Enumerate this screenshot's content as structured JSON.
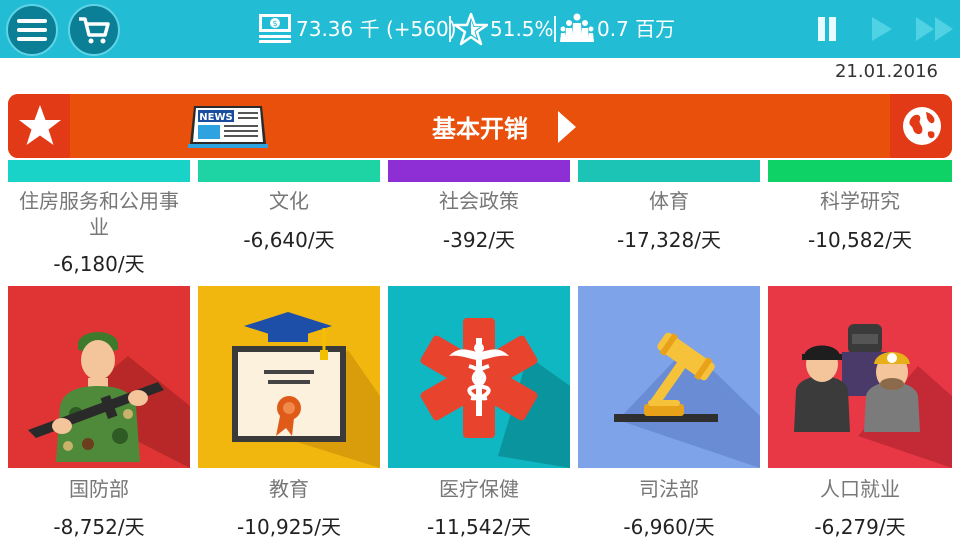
{
  "topbar": {
    "money": "73.36 千 (+560)",
    "approval": "51.5%",
    "population": "0.7 百万",
    "icons": [
      "menu-icon",
      "cart-icon",
      "money-icon",
      "star-icon",
      "people-icon",
      "pause-icon",
      "play-icon",
      "fast-forward-icon"
    ]
  },
  "date": "21.01.2016",
  "banner": {
    "title": "基本开销",
    "icons": [
      "star-icon",
      "news-icon",
      "arrow-right-icon",
      "globe-icon"
    ]
  },
  "top_cards": [
    {
      "label": "住房服务和公用事业",
      "value": "-6,180/天",
      "color": "#1ad3c8"
    },
    {
      "label": "文化",
      "value": "-6,640/天",
      "color": "#1fd4a4"
    },
    {
      "label": "社会政策",
      "value": "-392/天",
      "color": "#8e2fd6"
    },
    {
      "label": "体育",
      "value": "-17,328/天",
      "color": "#1cc4b6"
    },
    {
      "label": "科学研究",
      "value": "-10,582/天",
      "color": "#0fd266"
    }
  ],
  "bottom_cards": [
    {
      "label": "国防部",
      "value": "-8,752/天",
      "color": "#e03434",
      "icon": "soldier-icon"
    },
    {
      "label": "教育",
      "value": "-10,925/天",
      "color": "#f2b70f",
      "icon": "diploma-icon"
    },
    {
      "label": "医疗保健",
      "value": "-11,542/天",
      "color": "#0fb7c2",
      "icon": "medical-icon"
    },
    {
      "label": "司法部",
      "value": "-6,960/天",
      "color": "#7fa3e9",
      "icon": "gavel-icon"
    },
    {
      "label": "人口就业",
      "value": "-6,279/天",
      "color": "#e83846",
      "icon": "workers-icon"
    }
  ]
}
